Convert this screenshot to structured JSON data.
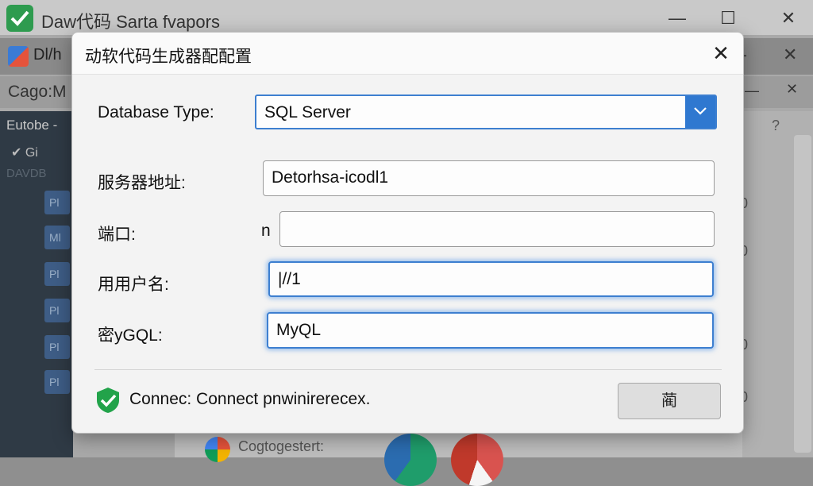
{
  "background": {
    "window_title": "Daw代码 Sarta fvapors",
    "inner_title": "Dl/h",
    "toolbar_label": "Cago:M",
    "sidebar_header": "Eutobe -",
    "sidebar_sub": "Gi",
    "sidebar_ghost": "DAVDB",
    "sidebar_items": [
      "Pl",
      "Ml",
      "Pl",
      "Pl",
      "Pl",
      "Pl"
    ],
    "right_glyphs": [
      "?",
      "0",
      "0",
      "0",
      "0",
      "0"
    ],
    "bottom_label": "Cogtogestert:"
  },
  "dialog": {
    "title": "动软代码生成器配配置",
    "close_glyph": "✕",
    "db_type_label": "Database Type:",
    "db_type_value": "SQL Server",
    "server_label": "服务器地址:",
    "server_value": "Detorhsa-icodl1",
    "port_label": "端口:",
    "port_prefix": "n",
    "port_value": "",
    "user_label": "用用户名:",
    "user_value": "|//1",
    "password_label": "密yGQL:",
    "password_value": "MyQL",
    "status_text": "Connec: Connect pnwinirerecex.",
    "ok_button": "蔺"
  },
  "colors": {
    "accent": "#2f78d0",
    "focus_glow": "#5096e6",
    "status_green": "#22a34a"
  }
}
